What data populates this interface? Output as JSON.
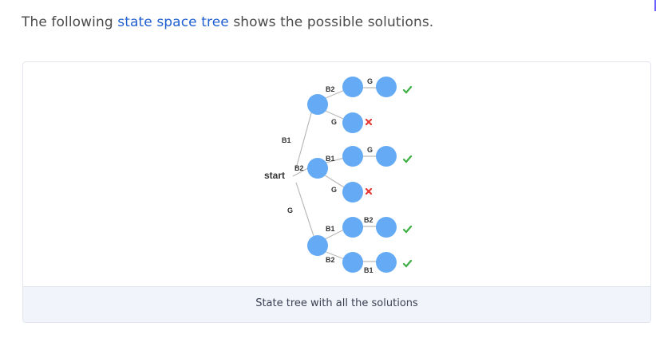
{
  "intro": {
    "before": "The following ",
    "link": "state space tree",
    "after": " shows the possible solutions."
  },
  "tree": {
    "root": "start",
    "edges": {
      "b1": "B1",
      "b2": "B2",
      "g": "G",
      "b1_b2": "B2",
      "b1_g": "G",
      "b1_b2_g": "G",
      "b2_b1": "B1",
      "b2_g": "G",
      "b2_b1_g": "G",
      "g_b1": "B1",
      "g_b2": "B2",
      "g_b1_b2": "B2",
      "g_b2_b1": "B1"
    },
    "outcomes": [
      "valid",
      "invalid",
      "valid",
      "invalid",
      "valid",
      "valid"
    ],
    "colors": {
      "node": "#64aaf5",
      "edge": "#b9b9b9",
      "valid": "#3cb043",
      "invalid": "#e53935"
    }
  },
  "caption": "State tree with all the solutions"
}
